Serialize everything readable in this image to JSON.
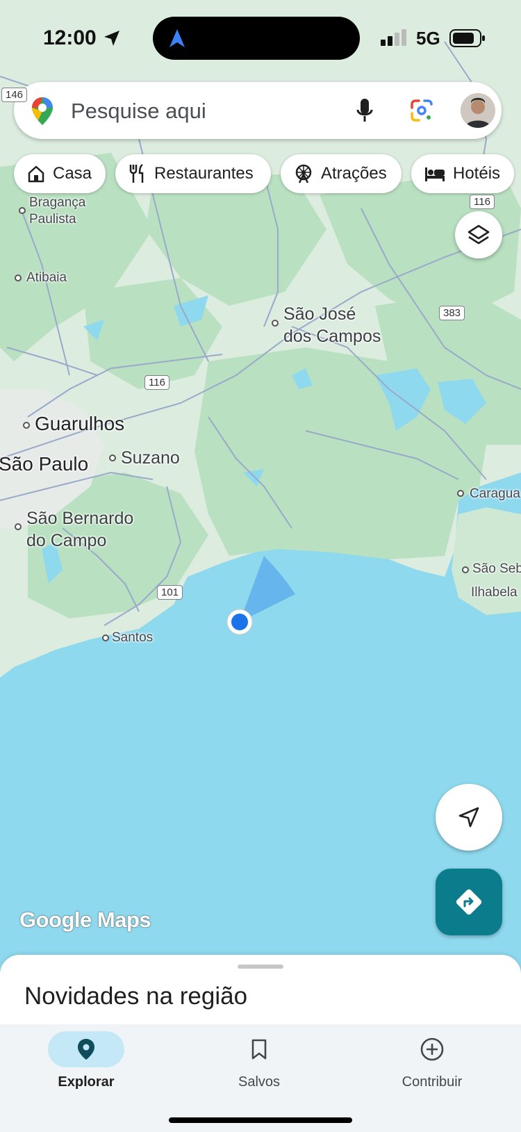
{
  "status_bar": {
    "time": "12:00",
    "network": "5G"
  },
  "search": {
    "placeholder": "Pesquise aqui"
  },
  "chips": [
    {
      "label": "Casa",
      "icon": "home-icon"
    },
    {
      "label": "Restaurantes",
      "icon": "fork-knife-icon"
    },
    {
      "label": "Atrações",
      "icon": "ferris-wheel-icon"
    },
    {
      "label": "Hotéis",
      "icon": "bed-icon"
    }
  ],
  "map": {
    "places": {
      "braganca": "Bragança\nPaulista",
      "atibaia": "Atibaia",
      "sao_jose": "São José\ndos Campos",
      "guarulhos": "Guarulhos",
      "sao_paulo": "São Paulo",
      "suzano": "Suzano",
      "sao_bernardo": "São Bernardo\ndo Campo",
      "santos": "Santos",
      "caragua": "Caragua",
      "sao_seb": "São Seb",
      "ilhabela": "Ilhabela"
    },
    "routes": {
      "r146": "146",
      "r116a": "116",
      "r383": "383",
      "r116b": "116",
      "r101": "101"
    }
  },
  "logo": "Google Maps",
  "sheet": {
    "title": "Novidades na região"
  },
  "nav": [
    {
      "label": "Explorar",
      "icon": "location-pin-icon",
      "active": true
    },
    {
      "label": "Salvos",
      "icon": "bookmark-icon",
      "active": false
    },
    {
      "label": "Contribuir",
      "icon": "plus-circle-icon",
      "active": false
    }
  ],
  "colors": {
    "water": "#8fd9ee",
    "land": "#dcecdf",
    "forest": "#b9e0c1",
    "accent": "#1a73e8",
    "directions": "#0b7c8c",
    "nav_active": "#c4e8f5"
  }
}
